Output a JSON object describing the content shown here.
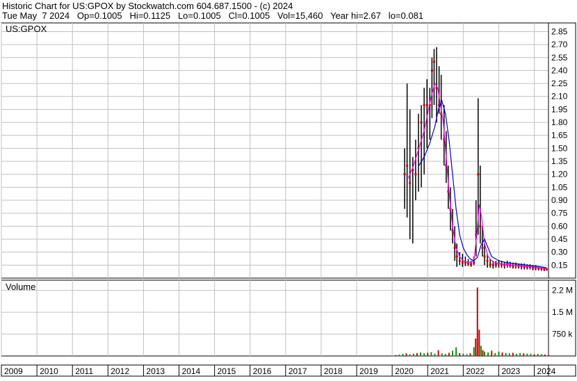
{
  "header": {
    "line1": "Historic Chart for US:GPOX by Stockwatch.com 604.687.1500 - (c) 2024",
    "line2": "Tue May  7 2024   Op=0.1005   Hi=0.1125   Lo=0.1005   Cl=0.1005   Vol=15,460   Year hi=2.67   lo=0.081"
  },
  "colors": {
    "background": "#ffffff",
    "grid": "#c0c0c0",
    "border": "#000000",
    "price_bar": "#000000",
    "close_marker": "#cc0000",
    "ma_short": "#ff00ff",
    "ma_long": "#0000cc",
    "volume_up": "#009900",
    "volume_down": "#cc0000"
  },
  "chart_data": [
    {
      "type": "line",
      "title": "US:GPOX",
      "xlabel": "",
      "ylabel": "",
      "x_ticks": [
        "2009",
        "2010",
        "2011",
        "2012",
        "2013",
        "2014",
        "2015",
        "2016",
        "2017",
        "2018",
        "2019",
        "2020",
        "2021",
        "2022",
        "2023",
        "2024"
      ],
      "y_ticks": [
        "0.15",
        "0.30",
        "0.45",
        "0.60",
        "0.75",
        "0.90",
        "1.05",
        "1.20",
        "1.35",
        "1.50",
        "1.65",
        "1.80",
        "1.95",
        "2.10",
        "2.25",
        "2.40",
        "2.55",
        "2.70",
        "2.85"
      ],
      "ylim": [
        0.0,
        2.95
      ],
      "xlim": [
        2009.0,
        2024.4
      ],
      "grid": true,
      "legend": "none",
      "series": [
        {
          "style": "high-low-bars",
          "points": [
            {
              "x": 2020.35,
              "low": 0.8,
              "high": 1.5,
              "close": 1.2
            },
            {
              "x": 2020.42,
              "low": 0.7,
              "high": 2.25,
              "close": 1.3
            },
            {
              "x": 2020.5,
              "low": 0.45,
              "high": 1.95,
              "close": 1.1
            },
            {
              "x": 2020.58,
              "low": 0.4,
              "high": 1.4,
              "close": 1.25
            },
            {
              "x": 2020.66,
              "low": 0.9,
              "high": 1.6,
              "close": 1.2
            },
            {
              "x": 2020.74,
              "low": 1.0,
              "high": 1.9,
              "close": 1.5
            },
            {
              "x": 2020.82,
              "low": 1.05,
              "high": 2.0,
              "close": 1.8
            },
            {
              "x": 2020.9,
              "low": 1.2,
              "high": 2.2,
              "close": 2.0
            },
            {
              "x": 2020.98,
              "low": 1.5,
              "high": 2.3,
              "close": 2.0
            },
            {
              "x": 2021.06,
              "low": 1.6,
              "high": 2.2,
              "close": 2.0
            },
            {
              "x": 2021.12,
              "low": 1.85,
              "high": 2.55,
              "close": 2.4
            },
            {
              "x": 2021.18,
              "low": 2.0,
              "high": 2.65,
              "close": 2.5
            },
            {
              "x": 2021.25,
              "low": 1.8,
              "high": 2.67,
              "close": 2.2
            },
            {
              "x": 2021.32,
              "low": 1.9,
              "high": 2.45,
              "close": 2.0
            },
            {
              "x": 2021.38,
              "low": 1.6,
              "high": 2.35,
              "close": 1.9
            },
            {
              "x": 2021.46,
              "low": 1.3,
              "high": 2.0,
              "close": 1.6
            },
            {
              "x": 2021.52,
              "low": 1.1,
              "high": 1.7,
              "close": 1.3
            },
            {
              "x": 2021.58,
              "low": 0.8,
              "high": 1.3,
              "close": 1.0
            },
            {
              "x": 2021.64,
              "low": 0.55,
              "high": 1.05,
              "close": 0.8
            },
            {
              "x": 2021.7,
              "low": 0.4,
              "high": 0.8,
              "close": 0.55
            },
            {
              "x": 2021.76,
              "low": 0.2,
              "high": 0.6,
              "close": 0.35
            },
            {
              "x": 2021.82,
              "low": 0.13,
              "high": 0.4,
              "close": 0.25
            },
            {
              "x": 2021.9,
              "low": 0.15,
              "high": 0.3,
              "close": 0.2
            },
            {
              "x": 2021.98,
              "low": 0.13,
              "high": 0.28,
              "close": 0.18
            },
            {
              "x": 2022.06,
              "low": 0.14,
              "high": 0.25,
              "close": 0.18
            },
            {
              "x": 2022.14,
              "low": 0.14,
              "high": 0.22,
              "close": 0.17
            },
            {
              "x": 2022.22,
              "low": 0.13,
              "high": 0.2,
              "close": 0.16
            },
            {
              "x": 2022.3,
              "low": 0.15,
              "high": 0.25,
              "close": 0.18
            },
            {
              "x": 2022.36,
              "low": 0.25,
              "high": 0.9,
              "close": 0.5
            },
            {
              "x": 2022.42,
              "low": 0.5,
              "high": 2.08,
              "close": 1.2
            },
            {
              "x": 2022.48,
              "low": 0.4,
              "high": 1.3,
              "close": 0.6
            },
            {
              "x": 2022.54,
              "low": 0.25,
              "high": 0.6,
              "close": 0.35
            },
            {
              "x": 2022.6,
              "low": 0.15,
              "high": 0.4,
              "close": 0.25
            },
            {
              "x": 2022.68,
              "low": 0.12,
              "high": 0.28,
              "close": 0.2
            },
            {
              "x": 2022.76,
              "low": 0.12,
              "high": 0.22,
              "close": 0.16
            },
            {
              "x": 2022.84,
              "low": 0.11,
              "high": 0.2,
              "close": 0.15
            },
            {
              "x": 2022.92,
              "low": 0.12,
              "high": 0.2,
              "close": 0.16
            },
            {
              "x": 2023.0,
              "low": 0.12,
              "high": 0.21,
              "close": 0.17
            },
            {
              "x": 2023.08,
              "low": 0.12,
              "high": 0.2,
              "close": 0.16
            },
            {
              "x": 2023.16,
              "low": 0.11,
              "high": 0.19,
              "close": 0.15
            },
            {
              "x": 2023.24,
              "low": 0.12,
              "high": 0.2,
              "close": 0.16
            },
            {
              "x": 2023.32,
              "low": 0.12,
              "high": 0.19,
              "close": 0.15
            },
            {
              "x": 2023.4,
              "low": 0.11,
              "high": 0.18,
              "close": 0.14
            },
            {
              "x": 2023.48,
              "low": 0.11,
              "high": 0.18,
              "close": 0.15
            },
            {
              "x": 2023.56,
              "low": 0.11,
              "high": 0.17,
              "close": 0.14
            },
            {
              "x": 2023.64,
              "low": 0.1,
              "high": 0.17,
              "close": 0.14
            },
            {
              "x": 2023.72,
              "low": 0.1,
              "high": 0.17,
              "close": 0.13
            },
            {
              "x": 2023.8,
              "low": 0.1,
              "high": 0.16,
              "close": 0.13
            },
            {
              "x": 2023.88,
              "low": 0.1,
              "high": 0.16,
              "close": 0.13
            },
            {
              "x": 2023.96,
              "low": 0.09,
              "high": 0.15,
              "close": 0.12
            },
            {
              "x": 2024.04,
              "low": 0.09,
              "high": 0.15,
              "close": 0.12
            },
            {
              "x": 2024.12,
              "low": 0.09,
              "high": 0.14,
              "close": 0.11
            },
            {
              "x": 2024.2,
              "low": 0.085,
              "high": 0.13,
              "close": 0.11
            },
            {
              "x": 2024.28,
              "low": 0.081,
              "high": 0.125,
              "close": 0.105
            },
            {
              "x": 2024.35,
              "low": 0.1005,
              "high": 0.1125,
              "close": 0.1005
            }
          ]
        },
        {
          "style": "line-short-ma",
          "x": [
            2020.45,
            2020.6,
            2020.75,
            2020.9,
            2021.0,
            2021.1,
            2021.2,
            2021.28,
            2021.36,
            2021.44,
            2021.52,
            2021.6,
            2021.7,
            2021.8,
            2021.9,
            2022.0,
            2022.15,
            2022.3,
            2022.38,
            2022.45,
            2022.52,
            2022.6,
            2022.7,
            2022.85,
            2023.0,
            2023.2,
            2023.4,
            2023.6,
            2023.8,
            2024.0,
            2024.2,
            2024.35
          ],
          "y": [
            1.15,
            1.3,
            1.5,
            1.7,
            1.9,
            2.1,
            2.25,
            2.2,
            2.0,
            1.8,
            1.4,
            1.0,
            0.6,
            0.35,
            0.25,
            0.2,
            0.18,
            0.2,
            0.5,
            0.85,
            0.7,
            0.4,
            0.25,
            0.18,
            0.17,
            0.16,
            0.15,
            0.14,
            0.14,
            0.13,
            0.12,
            0.11
          ]
        },
        {
          "style": "line-long-ma",
          "x": [
            2020.75,
            2020.9,
            2021.05,
            2021.2,
            2021.3,
            2021.4,
            2021.5,
            2021.6,
            2021.7,
            2021.8,
            2021.9,
            2022.0,
            2022.1,
            2022.2,
            2022.3,
            2022.4,
            2022.5,
            2022.6,
            2022.7,
            2022.8,
            2023.0,
            2023.2,
            2023.4,
            2023.6,
            2023.8,
            2024.0,
            2024.2,
            2024.35
          ],
          "y": [
            1.3,
            1.4,
            1.55,
            1.75,
            1.95,
            2.05,
            1.9,
            1.6,
            1.2,
            0.8,
            0.5,
            0.35,
            0.27,
            0.22,
            0.2,
            0.24,
            0.38,
            0.45,
            0.35,
            0.25,
            0.2,
            0.18,
            0.17,
            0.16,
            0.15,
            0.14,
            0.13,
            0.12
          ]
        }
      ]
    },
    {
      "type": "bar",
      "title": "Volume",
      "xlabel": "",
      "ylabel": "",
      "y_ticks": [
        "750 k",
        "1.5 M",
        "2.2 M"
      ],
      "ylim": [
        0,
        2600000
      ],
      "xlim": [
        2009.0,
        2024.4
      ],
      "grid": true,
      "legend": "none",
      "x": [
        2020.1,
        2020.2,
        2020.3,
        2020.4,
        2020.5,
        2020.6,
        2020.7,
        2020.8,
        2020.9,
        2021.0,
        2021.1,
        2021.2,
        2021.3,
        2021.4,
        2021.5,
        2021.6,
        2021.7,
        2021.8,
        2021.9,
        2022.0,
        2022.1,
        2022.2,
        2022.3,
        2022.35,
        2022.4,
        2022.45,
        2022.5,
        2022.55,
        2022.6,
        2022.7,
        2022.8,
        2022.9,
        2023.0,
        2023.1,
        2023.2,
        2023.3,
        2023.4,
        2023.5,
        2023.6,
        2023.7,
        2023.8,
        2023.9,
        2024.0,
        2024.1,
        2024.2,
        2024.3
      ],
      "values": [
        30000,
        50000,
        70000,
        90000,
        60000,
        80000,
        100000,
        120000,
        90000,
        110000,
        130000,
        80000,
        200000,
        90000,
        70000,
        110000,
        180000,
        300000,
        100000,
        80000,
        60000,
        90000,
        300000,
        600000,
        2350000,
        900000,
        350000,
        200000,
        150000,
        120000,
        180000,
        100000,
        150000,
        120000,
        100000,
        90000,
        110000,
        80000,
        100000,
        90000,
        80000,
        70000,
        60000,
        70000,
        60000,
        50000
      ]
    }
  ]
}
